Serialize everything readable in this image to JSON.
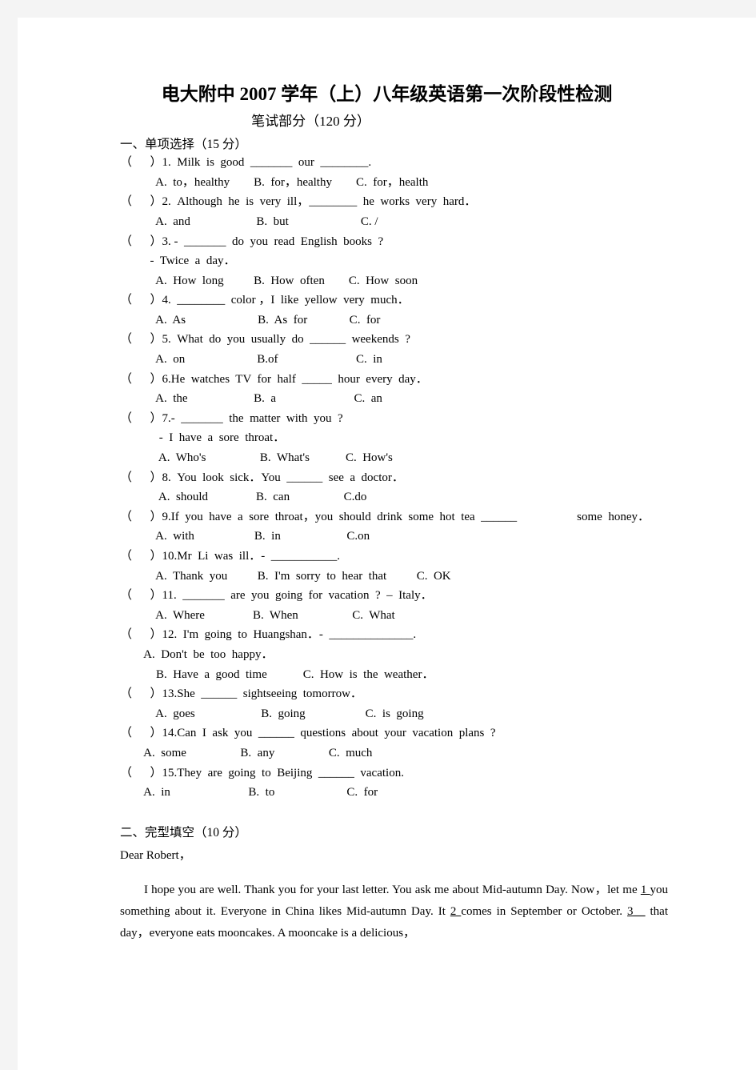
{
  "document": {
    "title_prefix": "电大附中",
    "title_year": "2007",
    "title_suffix": "学年（上）八年级英语第一次阶段性检测",
    "title_full": "电大附中 2007 学年（上）八年级英语第一次阶段性检测",
    "subtitle": "笔试部分（120 分）"
  },
  "sections": [
    {
      "heading": "一、单项选择（15 分）",
      "questions": [
        {
          "marker": "（      ）1.",
          "stem": "（      ）1.  Milk  is  good  _______  our  ________.",
          "options_lines": [
            "            A.  to，healthy        B.  for，healthy        C.  for，health"
          ]
        },
        {
          "marker": "（      ）2.",
          "stem": "（      ）2.  Although  he  is  very  ill，________  he  works  very  hard．",
          "options_lines": [
            "            A.  and                      B.  but                        C. /"
          ]
        },
        {
          "marker": "（      ）3.",
          "stem": "（      ）3. -  _______  do  you  read  English  books  ?",
          "continuation": "          -  Twice  a  day．",
          "options_lines": [
            "            A.  How  long          B.  How  often        C.  How  soon"
          ]
        },
        {
          "marker": "（      ）4.",
          "stem": "（      ）4.  ________  color ，I  like  yellow  very  much．",
          "options_lines": [
            "            A.  As                        B.  As  for              C.  for"
          ]
        },
        {
          "marker": "（      ）5.",
          "stem": "（      ）5.  What  do  you  usually  do  ______  weekends  ?",
          "options_lines": [
            "            A.  on                        B.of                          C.  in"
          ]
        },
        {
          "marker": "（      ）6.",
          "stem": "（      ）6.He  watches  TV  for  half  _____  hour  every  day．",
          "options_lines": [
            "            A.  the                      B.  a                          C.  an"
          ]
        },
        {
          "marker": "（      ）7.",
          "stem": "（      ）7.-  _______  the  matter  with  you  ?",
          "continuation": "             -  I  have  a  sore  throat．",
          "options_lines": [
            "             A.  Who's                  B.  What's            C.  How's"
          ]
        },
        {
          "marker": "（      ）8.",
          "stem": "（      ）8.  You  look  sick．You  ______  see  a  doctor．",
          "options_lines": [
            "             A.  should                B.  can                  C.do"
          ]
        },
        {
          "marker": "（      ）9.",
          "stem": "（      ）9.If  you  have  a  sore  throat，you  should  drink  some  hot  tea  ______                    some  honey．",
          "options_lines": [
            "            A.  with                    B.  in                      C.on"
          ]
        },
        {
          "marker": "（      ）10.",
          "stem": "（      ）10.Mr  Li  was  ill．-  ___________.",
          "options_lines": [
            "            A.  Thank  you          B.  I'm  sorry  to  hear  that          C.  OK"
          ]
        },
        {
          "marker": "（      ）11.",
          "stem": "（      ）11.  _______  are  you  going  for  vacation  ?  –  Italy．",
          "options_lines": [
            "            A.  Where                B.  When                  C.  What"
          ]
        },
        {
          "marker": "（      ）12.",
          "stem": "（      ）12.  I'm  going  to  Huangshan．-  ______________.",
          "options_lines": [
            "        A.  Don't  be  too  happy．",
            "            B.  Have  a  good  time            C.  How  is  the  weather．"
          ]
        },
        {
          "marker": "（      ）13.",
          "stem": "（      ）13.She  ______  sightseeing  tomorrow．",
          "options_lines": [
            "            A.  goes                      B.  going                    C.  is  going"
          ]
        },
        {
          "marker": "（      ）14.",
          "stem": "（      ）14.Can  I  ask  you  ______  questions  about  your  vacation  plans  ?",
          "options_lines": [
            "        A.  some                  B.  any                  C.  much"
          ]
        },
        {
          "marker": "（      ）15.",
          "stem": "（      ）15.They  are  going  to  Beijing  ______  vacation.",
          "options_lines": [
            "        A.  in                          B.  to                        C.  for"
          ]
        }
      ]
    }
  ],
  "cloze": {
    "heading": "二、完型填空（10 分）",
    "salutation": "Dear  Robert，",
    "paragraph_parts": {
      "p1": "I  hope  you  are  well.  Thank  you  for  your  last  letter.  You  ask  me  about  Mid-autumn  Day.  Now，let  me  ",
      "gap1": " 1 ",
      "p2": "you  something  about  it.  Everyone  in  China  likes  Mid-autumn  Day.  It  ",
      "gap2": " 2 ",
      "p3": "  comes  in  September  or  October. ",
      "gap3": "3",
      "gap3_tail": "__",
      "p4": "  that  day，everyone  eats  mooncakes.  A  mooncake  is  a  delicious，"
    }
  },
  "colors": {
    "page_background": "#ffffff",
    "outer_background": "#f4f4f4",
    "text": "#000000"
  }
}
